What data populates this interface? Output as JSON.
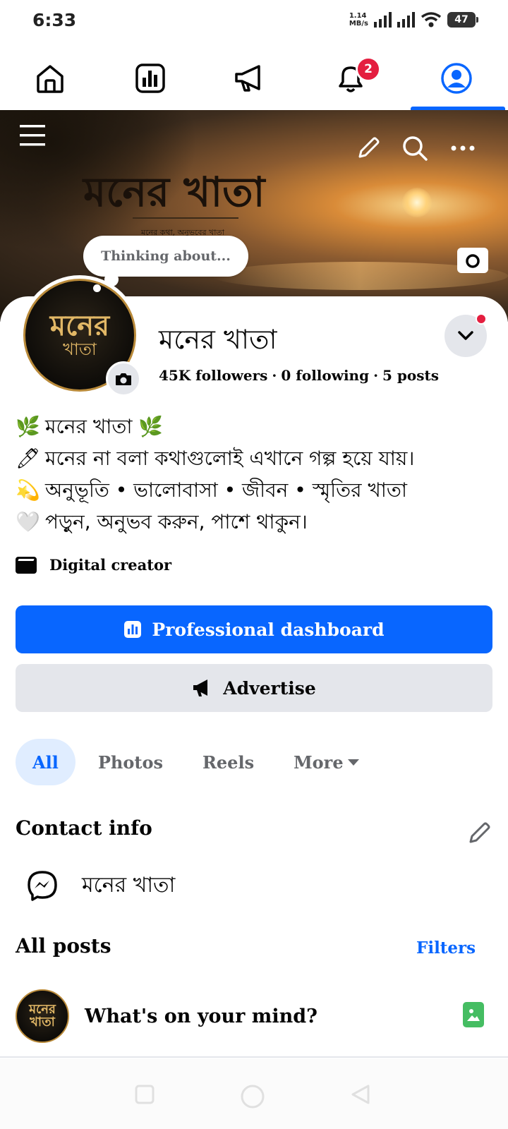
{
  "status_bar": {
    "time": "6:33",
    "net_speed_value": "1.14",
    "net_speed_unit": "MB/s",
    "battery": "47"
  },
  "nav": {
    "items": [
      {
        "name": "home",
        "icon": "home-icon"
      },
      {
        "name": "dashboard",
        "icon": "bar-chart-icon"
      },
      {
        "name": "ads",
        "icon": "megaphone-icon"
      },
      {
        "name": "notifications",
        "icon": "bell-icon",
        "badge": "2"
      },
      {
        "name": "profile",
        "icon": "profile-icon",
        "active": true
      }
    ]
  },
  "cover": {
    "title": "মনের খাতা",
    "subtitle": "মনের কথা, অনুভবের খাতা"
  },
  "profile": {
    "thought_bubble": "Thinking about...",
    "avatar_line1": "মনের",
    "avatar_line2": "খাতা",
    "name": "মনের খাতা",
    "followers": "45K followers",
    "following": "0 following",
    "posts": "5 posts",
    "separator": "·"
  },
  "bio": [
    {
      "emoji": "🌿",
      "text": "মনের খাতা 🌿"
    },
    {
      "emoji": "🖊",
      "text": "মনের না বলা কথাগুলোই এখানে গল্প হয়ে যায়।"
    },
    {
      "emoji": "💫",
      "text": "অনুভূতি • ভালোবাসা • জীবন • স্মৃতির খাতা"
    },
    {
      "emoji": "🤍",
      "text": "পড়ুন, অনুভব করুন, পাশে থাকুন।"
    }
  ],
  "category": "Digital creator",
  "buttons": {
    "dashboard": "Professional dashboard",
    "advertise": "Advertise"
  },
  "tabs": [
    "All",
    "Photos",
    "Reels",
    "More"
  ],
  "contact": {
    "title": "Contact info",
    "messenger": "মনের খাতা"
  },
  "posts": {
    "title": "All posts",
    "filters": "Filters",
    "composer_placeholder": "What's on your mind?"
  },
  "colors": {
    "accent": "#0866ff",
    "badge": "#e41e3f",
    "secondary_button": "#e4e6eb",
    "photo_icon": "#45bd62"
  }
}
